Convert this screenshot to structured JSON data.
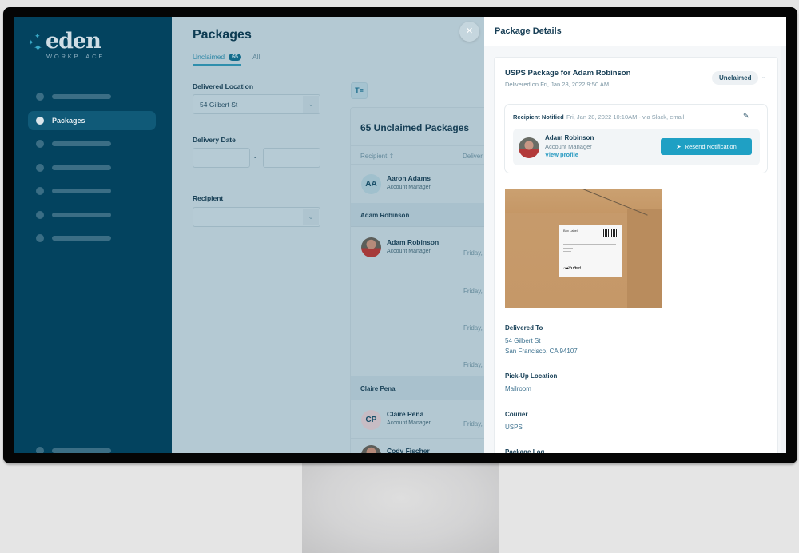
{
  "brand": {
    "name": "eden",
    "sub": "WORKPLACE",
    "accent": "#3aa9c7",
    "sidebar_bg": "#03435f"
  },
  "sidebar": {
    "items": [
      {
        "label": "",
        "placeholder": true
      },
      {
        "label": "Packages",
        "active": true
      },
      {
        "label": "",
        "placeholder": true
      },
      {
        "label": "",
        "placeholder": true
      },
      {
        "label": "",
        "placeholder": true
      },
      {
        "label": "",
        "placeholder": true
      },
      {
        "label": "",
        "placeholder": true
      }
    ]
  },
  "main": {
    "title": "Packages",
    "tabs": [
      {
        "label": "Unclaimed",
        "count": "65",
        "active": true
      },
      {
        "label": "All",
        "active": false
      }
    ],
    "filters": {
      "delivered_location": {
        "label": "Delivered Location",
        "value": "54 Gilbert St"
      },
      "delivery_date": {
        "label": "Delivery Date",
        "from": "",
        "to": "",
        "separator": "-"
      },
      "recipient": {
        "label": "Recipient",
        "value": ""
      }
    },
    "list": {
      "title": "65 Unclaimed Packages",
      "columns": [
        "Recipient",
        "Deliver"
      ],
      "sort_icon": "⇕",
      "rows": [
        {
          "type": "person",
          "initials": "AA",
          "name": "Aaron Adams",
          "role": "Account Manager",
          "date": ""
        },
        {
          "type": "group",
          "name": "Adam Robinson"
        },
        {
          "type": "person",
          "photo": true,
          "name": "Adam Robinson",
          "role": "Account Manager",
          "date": "Friday,"
        },
        {
          "type": "date",
          "date": "Friday,"
        },
        {
          "type": "date",
          "date": "Friday,"
        },
        {
          "type": "date",
          "date": "Friday,"
        },
        {
          "type": "group",
          "name": "Claire Pena"
        },
        {
          "type": "person",
          "initials": "CP",
          "name": "Claire Pena",
          "role": "Account Manager",
          "date": "Friday,"
        },
        {
          "type": "person",
          "photo": true,
          "name": "Cody Fischer",
          "role": "",
          "date": ""
        }
      ]
    }
  },
  "details": {
    "title": "Package Details",
    "close_icon": "×",
    "package_title": "USPS Package for Adam Robinson",
    "delivered_on": "Delivered on Fri, Jan 28, 2022 9:50 AM",
    "status": "Unclaimed",
    "notification": {
      "label": "Recipient Notified",
      "meta": "Fri, Jan 28, 2022 10:10AM - via Slack, email",
      "recipient_name": "Adam Robinson",
      "recipient_role": "Account Manager",
      "view_profile": "View profile",
      "resend_label": "Resend Notification"
    },
    "image": {
      "label_title": "Box Label",
      "label_footer": "Your Brand"
    },
    "delivered_to": {
      "label": "Delivered To",
      "line1": "54 Gilbert St",
      "line2": "San Francisco, CA 94107"
    },
    "pickup": {
      "label": "Pick-Up Location",
      "value": "Mailroom"
    },
    "courier": {
      "label": "Courier",
      "value": "USPS"
    },
    "log": {
      "label": "Package Log"
    },
    "button_color": "#1fa0c4"
  }
}
